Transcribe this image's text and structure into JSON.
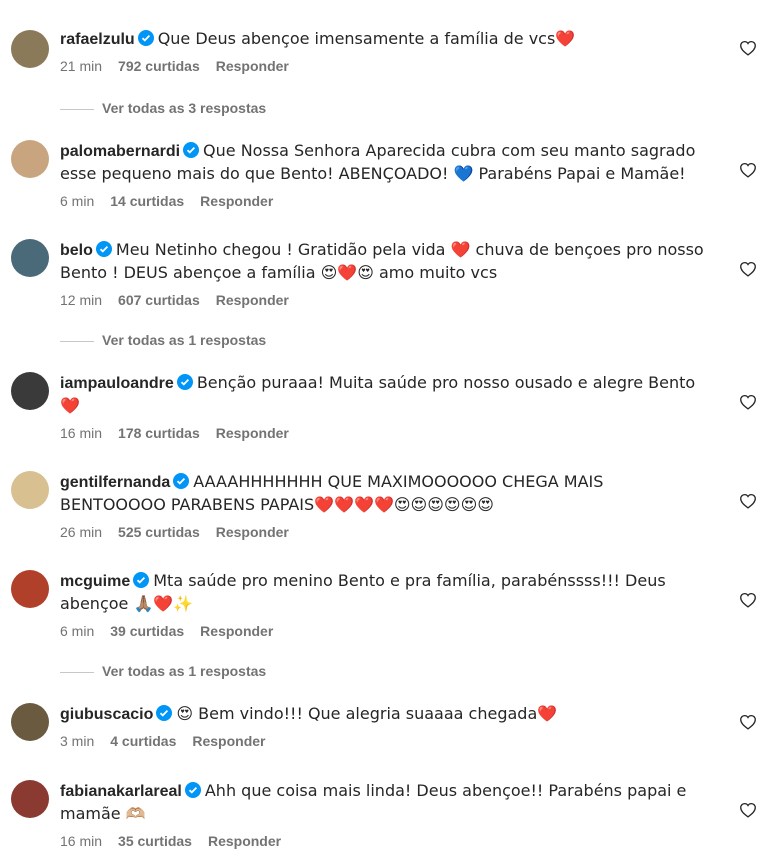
{
  "comments": [
    {
      "username": "rafaelzulu",
      "text": "Que Deus abençoe imensamente a família de vcs❤️",
      "time": "21 min",
      "likes": "792 curtidas",
      "reply": "Responder",
      "avatar_color": "#8a7a5a"
    },
    {
      "username": "palomabernardi",
      "text": "Que Nossa Senhora Aparecida cubra com seu manto sagrado esse pequeno mais do que Bento! ABENÇOADO! 💙 Parabéns Papai e Mamãe!",
      "time": "6 min",
      "likes": "14 curtidas",
      "reply": "Responder",
      "avatar_color": "#c9a57f"
    },
    {
      "username": "belo",
      "text": "Meu Netinho chegou ! Gratidão pela vida ❤️ chuva de bençoes pro nosso Bento ! DEUS abençoe a família 😍❤️😍 amo muito vcs",
      "time": "12 min",
      "likes": "607 curtidas",
      "reply": "Responder",
      "avatar_color": "#4a6a7a"
    },
    {
      "username": "iampauloandre",
      "text": "Benção puraaa! Muita saúde pro nosso ousado e alegre Bento ❤️",
      "time": "16 min",
      "likes": "178 curtidas",
      "reply": "Responder",
      "avatar_color": "#3a3a3a"
    },
    {
      "username": "gentilfernanda",
      "text": "AAAAHHHHHHH QUE MAXIMOOOOOO CHEGA MAIS BENTOOOOO PARABENS PAPAIS❤️❤️❤️❤️😍😍😍😍😍😍",
      "time": "26 min",
      "likes": "525 curtidas",
      "reply": "Responder",
      "avatar_color": "#d8c090"
    },
    {
      "username": "mcguime",
      "text": "Mta saúde pro menino Bento e pra família, parabénssss!!! Deus abençoe 🙏🏽❤️✨",
      "time": "6 min",
      "likes": "39 curtidas",
      "reply": "Responder",
      "avatar_color": "#b0402a"
    },
    {
      "username": "giubuscacio",
      "text": "😍 Bem vindo!!! Que alegria suaaaa chegada❤️",
      "time": "3 min",
      "likes": "4 curtidas",
      "reply": "Responder",
      "avatar_color": "#6a5a40"
    },
    {
      "username": "fabianakarlareal",
      "text": "Ahh que coisa mais linda! Deus abençoe!! Parabéns papai e mamãe 🫶🏼",
      "time": "16 min",
      "likes": "35 curtidas",
      "reply": "Responder",
      "avatar_color": "#8a3a30"
    }
  ],
  "threads": [
    {
      "label": "Ver todas as 3 respostas"
    },
    {
      "label": "Ver todas as 1 respostas"
    },
    {
      "label": "Ver todas as 1 respostas"
    }
  ],
  "colors": {
    "verified": "#0095f6",
    "meta": "#737373",
    "text": "#262626"
  }
}
